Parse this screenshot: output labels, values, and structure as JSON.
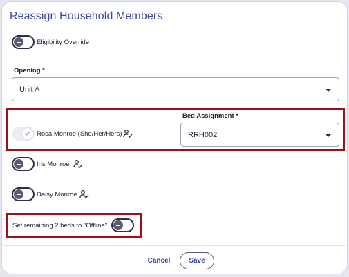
{
  "dialog": {
    "title": "Reassign Household Members"
  },
  "eligibility": {
    "label": "Eligibility Override",
    "on": false
  },
  "opening": {
    "label": "Opening *",
    "value": "Unit A"
  },
  "members": [
    {
      "name": "Rosa Monroe (She/Her/Hers)",
      "on": true,
      "icon": "person-check-icon"
    },
    {
      "name": "Iris Monroe",
      "on": false,
      "icon": "person-check-icon"
    },
    {
      "name": "Daisy Monroe",
      "on": false,
      "icon": "person-check-icon"
    }
  ],
  "bed_assignment": {
    "label": "Bed Assignment *",
    "value": "RRH002"
  },
  "offline": {
    "label": "Set remaining 2 beds to \"Offline\"",
    "on": false
  },
  "footer": {
    "cancel_label": "Cancel",
    "save_label": "Save"
  },
  "colors": {
    "accent": "#3a4aa6",
    "highlight": "#9e0f1a"
  }
}
